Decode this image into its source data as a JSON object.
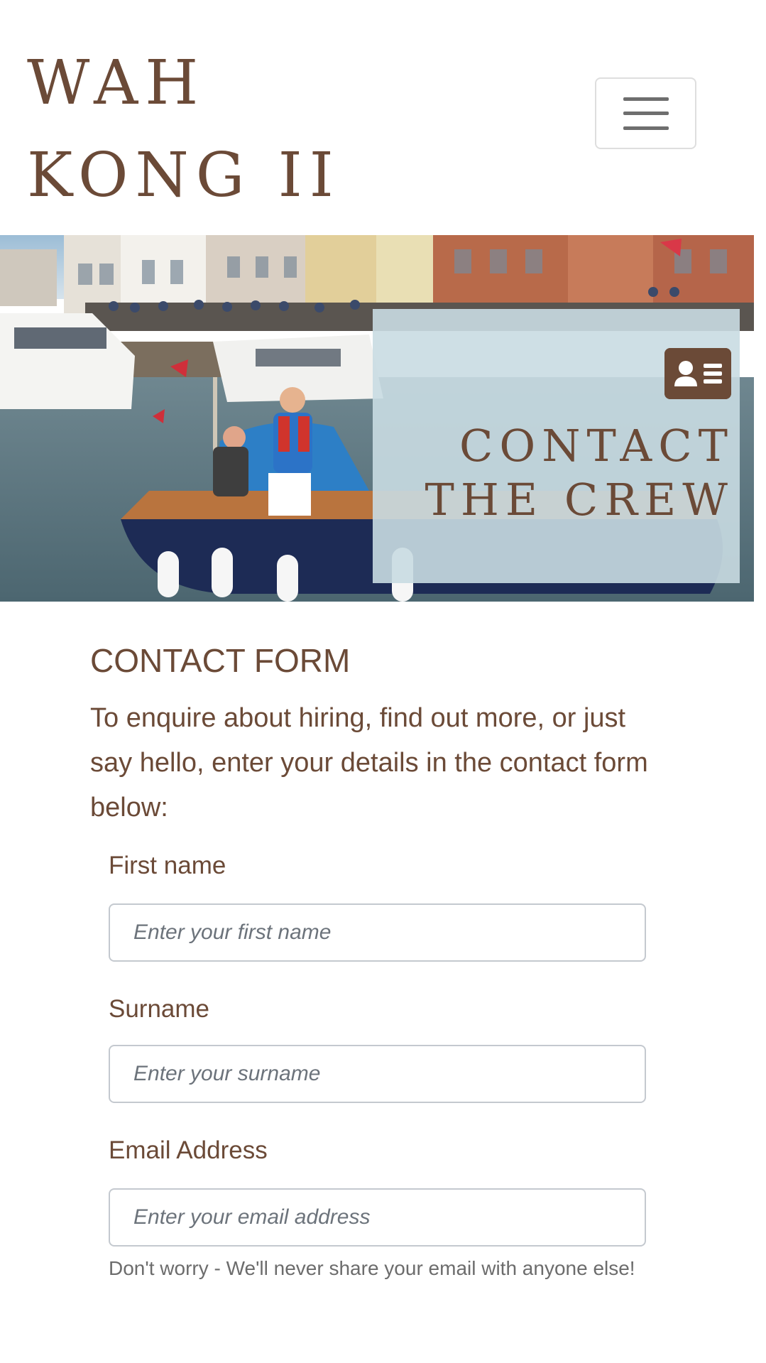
{
  "site": {
    "brand_line1": "WAH",
    "brand_line2": "KONG II"
  },
  "nav": {
    "toggle_icon": "hamburger-menu-icon"
  },
  "hero": {
    "icon": "contact-card-icon",
    "title_line1": "CONTACT",
    "title_line2": "THE CREW"
  },
  "form": {
    "title": "CONTACT FORM",
    "intro": "To enquire about hiring, find out more, or just say hello, enter your details in the contact form below:",
    "first_name": {
      "label": "First name",
      "placeholder": "Enter your first name",
      "value": ""
    },
    "surname": {
      "label": "Surname",
      "placeholder": "Enter your surname",
      "value": ""
    },
    "email": {
      "label": "Email Address",
      "placeholder": "Enter your email address",
      "value": "",
      "help": "Don't worry - We'll never share your email with anyone else!"
    }
  },
  "colors": {
    "brand_brown": "#6b4a37",
    "panel_overlay": "#c9dce2",
    "input_border": "#c4c9cf"
  }
}
